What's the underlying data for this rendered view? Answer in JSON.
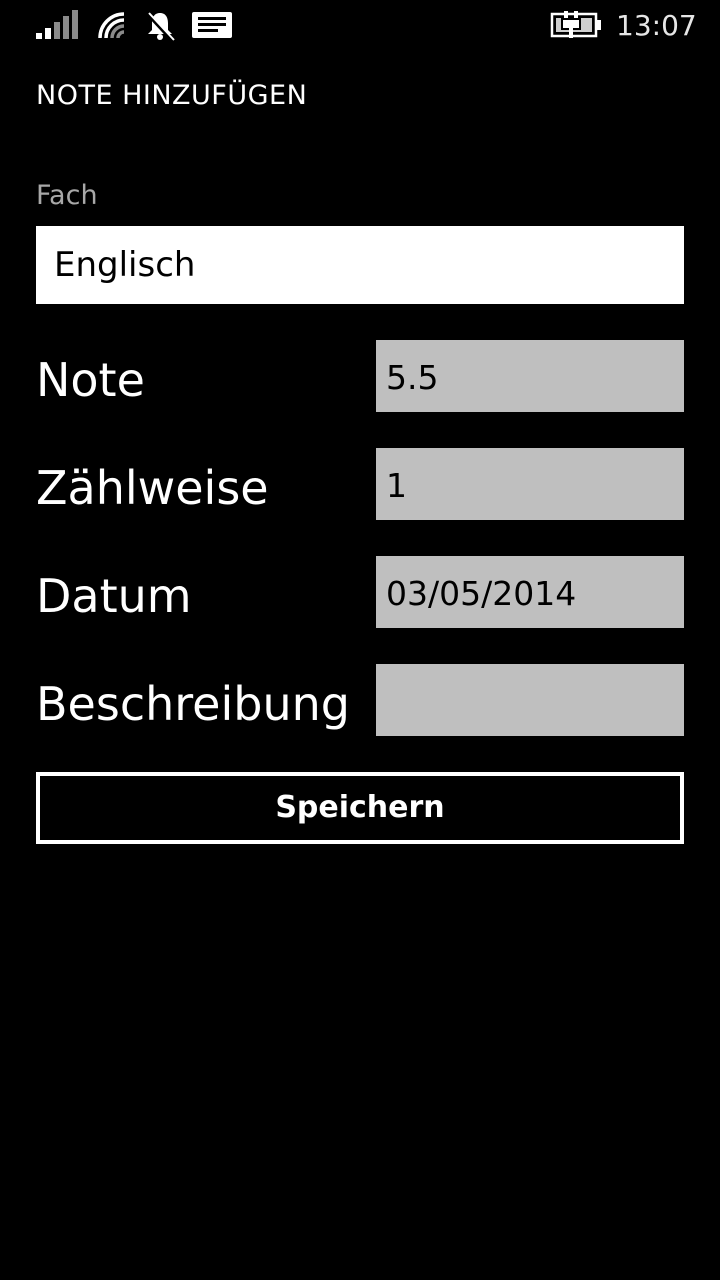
{
  "status_bar": {
    "icons": [
      "signal-strength-icon",
      "wifi-icon",
      "quiet-hours-bell-icon",
      "message-icon",
      "battery-charging-icon"
    ],
    "time": "13:07"
  },
  "header": {
    "title": "NOTE HINZUFÜGEN"
  },
  "form": {
    "subject": {
      "label": "Fach",
      "value": "Englisch"
    },
    "grade": {
      "label": "Note",
      "value": "5.5"
    },
    "weight": {
      "label": "Zählweise",
      "value": "1"
    },
    "date": {
      "label": "Datum",
      "value": "03/05/2014"
    },
    "description": {
      "label": "Beschreibung",
      "value": ""
    },
    "save_label": "Speichern"
  },
  "colors": {
    "background": "#000000",
    "input_gray": "#bfbfbf",
    "label_gray": "#a8a8a8",
    "foreground": "#ffffff"
  }
}
